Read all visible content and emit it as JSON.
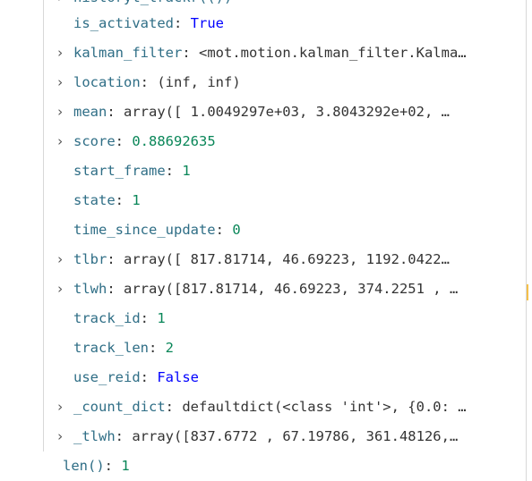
{
  "partial_top": {
    "text": "historyt_trackr(())"
  },
  "variables": [
    {
      "name": "is_activated",
      "value": "True",
      "type": "bool",
      "expandable": false
    },
    {
      "name": "kalman_filter",
      "value": "<mot.motion.kalman_filter.Kalma…",
      "type": "default",
      "expandable": true
    },
    {
      "name": "location",
      "value": "(inf, inf)",
      "type": "default",
      "expandable": true
    },
    {
      "name": "mean",
      "value": "array([ 1.0049297e+03,  3.8043292e+02,  …",
      "type": "default",
      "expandable": true
    },
    {
      "name": "score",
      "value": "0.88692635",
      "type": "number",
      "expandable": true
    },
    {
      "name": "start_frame",
      "value": "1",
      "type": "number",
      "expandable": false
    },
    {
      "name": "state",
      "value": "1",
      "type": "number",
      "expandable": false
    },
    {
      "name": "time_since_update",
      "value": "0",
      "type": "number",
      "expandable": false
    },
    {
      "name": "tlbr",
      "value": "array([ 817.81714,   46.69223, 1192.0422…",
      "type": "default",
      "expandable": true
    },
    {
      "name": "tlwh",
      "value": "array([817.81714,  46.69223, 374.2251 , …",
      "type": "default",
      "expandable": true
    },
    {
      "name": "track_id",
      "value": "1",
      "type": "number",
      "expandable": false
    },
    {
      "name": "track_len",
      "value": "2",
      "type": "number",
      "expandable": false
    },
    {
      "name": "use_reid",
      "value": "False",
      "type": "bool",
      "expandable": false
    },
    {
      "name": "_count_dict",
      "value": "defaultdict(<class 'int'>, {0.0: …",
      "type": "default",
      "expandable": true
    },
    {
      "name": "_tlwh",
      "value": "array([837.6772 ,  67.19786, 361.48126,…",
      "type": "default",
      "expandable": true
    }
  ],
  "len_row": {
    "name": "len()",
    "value": "1"
  },
  "icons": {
    "expand": "chevron-right-icon"
  },
  "colors": {
    "name": "#2f6e86",
    "number": "#098658",
    "bool": "#0000ff",
    "default": "#333333"
  }
}
